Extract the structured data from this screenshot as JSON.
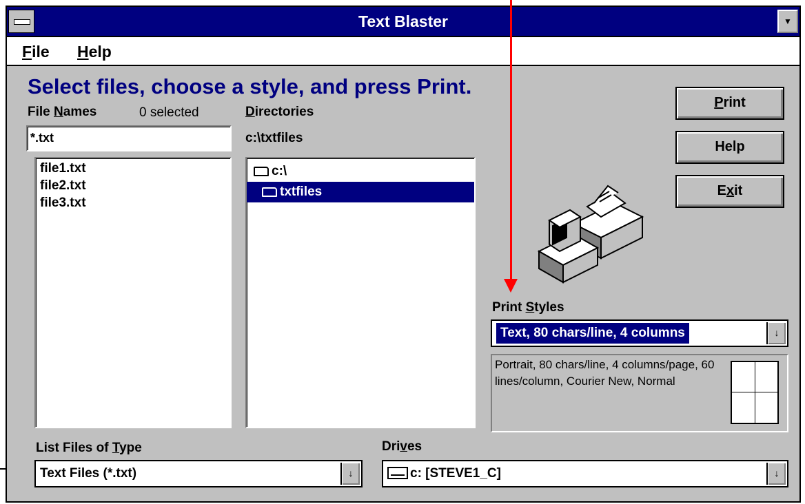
{
  "window": {
    "title": "Text Blaster",
    "minimize_glyph": "▼"
  },
  "menu": {
    "file_first": "F",
    "file_rest": "ile",
    "help_first": "H",
    "help_rest": "elp"
  },
  "instruction": "Select files, choose a style, and press Print.",
  "file_names": {
    "label_pre": "File ",
    "label_key": "N",
    "label_post": "ames",
    "selected_count": "0 selected",
    "pattern": "*.txt",
    "files": [
      "file1.txt",
      "file2.txt",
      "file3.txt"
    ]
  },
  "directories": {
    "label_key": "D",
    "label_post": "irectories",
    "current_path": "c:\\txtfiles",
    "items": [
      {
        "name": "c:\\",
        "selected": false
      },
      {
        "name": "txtfiles",
        "selected": true
      }
    ]
  },
  "buttons": {
    "print_key": "P",
    "print_rest": "rint",
    "help": "Help",
    "exit_pre": "E",
    "exit_key": "x",
    "exit_post": "it"
  },
  "print_styles": {
    "label_pre": "Print ",
    "label_key": "S",
    "label_post": "tyles",
    "selected": "Text, 80 chars/line, 4 columns",
    "description": "Portrait, 80 chars/line, 4 columns/page, 60 lines/column, Courier New, Normal"
  },
  "file_type": {
    "label_pre": "List Files of ",
    "label_key": "T",
    "label_post": "ype",
    "value": "Text Files (*.txt)"
  },
  "drives": {
    "label_pre": "Dri",
    "label_key": "v",
    "label_post": "es",
    "value": "c: [STEVE1_C]"
  },
  "dropdown_glyph": "↓",
  "colors": {
    "title_bar": "#000080",
    "instruction_text": "#000080",
    "selection": "#000080",
    "dialog_bg": "#c0c0c0",
    "arrow": "#ff0000"
  },
  "icons": [
    "system-menu-icon",
    "folder-open-icon",
    "printer-icon",
    "drive-icon",
    "dropdown-arrow-icon"
  ]
}
